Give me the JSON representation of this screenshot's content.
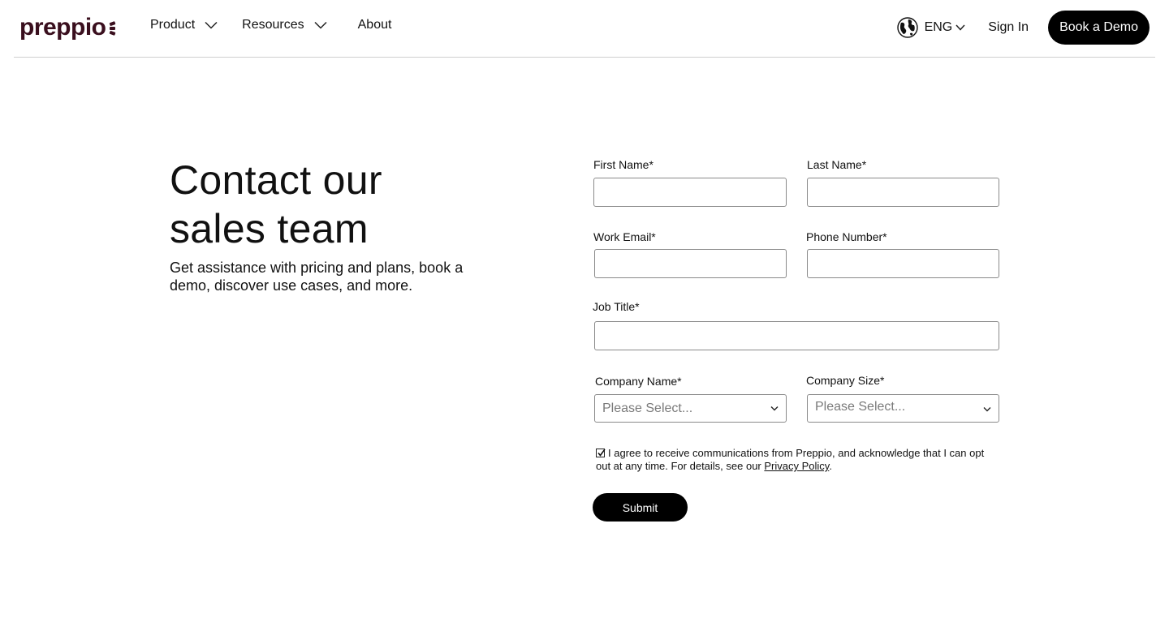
{
  "header": {
    "logo_text": "preppio",
    "nav": {
      "product": "Product",
      "resources": "Resources",
      "about": "About"
    },
    "language": "ENG",
    "sign_in": "Sign In",
    "book_demo": "Book a Demo"
  },
  "hero": {
    "title_line1": "Contact our",
    "title_line2": "sales team",
    "subtitle": "Get assistance with pricing and plans, book a demo, discover use cases, and more."
  },
  "form": {
    "first_name_label": "First Name*",
    "first_name_value": "",
    "last_name_label": "Last Name*",
    "last_name_value": "",
    "work_email_label": "Work Email*",
    "work_email_value": "",
    "phone_label": "Phone Number*",
    "phone_value": "",
    "job_title_label": "Job Title*",
    "job_title_value": "",
    "company_name_label": "Company Name*",
    "company_name_selected": "Please Select...",
    "company_size_label": "Company Size*",
    "company_size_selected": "Please Select...",
    "consent_checked": true,
    "consent_text": "I agree to receive communications from Preppio, and acknowledge that I can opt out at any time. For details, see our ",
    "privacy_link": "Privacy Policy",
    "consent_end": ".",
    "submit_label": "Submit"
  },
  "colors": {
    "brand": "#3a0f1e",
    "button_bg": "#000000",
    "border": "#8a8a8a"
  }
}
